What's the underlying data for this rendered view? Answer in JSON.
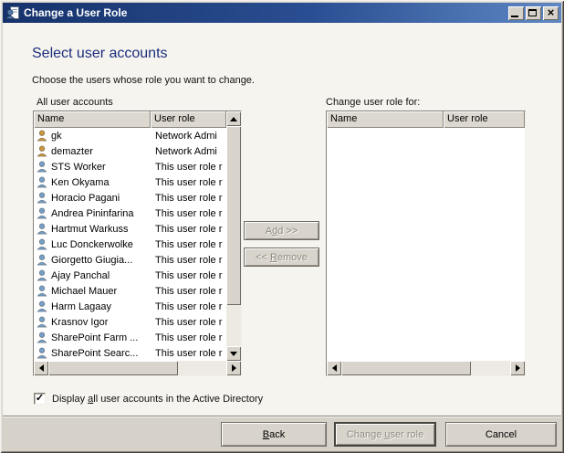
{
  "window": {
    "title": "Change a User Role",
    "close_glyph": "×"
  },
  "heading": "Select user accounts",
  "subheading": "Choose the users whose role you want to change.",
  "left_list": {
    "label": "All user accounts",
    "columns": [
      "Name",
      "User role"
    ],
    "users": [
      {
        "name": "gk",
        "role": "Network Admi",
        "type": "admin"
      },
      {
        "name": "demazter",
        "role": "Network Admi",
        "type": "admin"
      },
      {
        "name": "STS Worker",
        "role": "This user role r",
        "type": "user"
      },
      {
        "name": "Ken Okyama",
        "role": "This user role r",
        "type": "user"
      },
      {
        "name": "Horacio Pagani",
        "role": "This user role r",
        "type": "user"
      },
      {
        "name": "Andrea Pininfarina",
        "role": "This user role r",
        "type": "user"
      },
      {
        "name": "Hartmut Warkuss",
        "role": "This user role r",
        "type": "user"
      },
      {
        "name": "Luc Donckerwolke",
        "role": "This user role r",
        "type": "user"
      },
      {
        "name": "Giorgetto Giugia...",
        "role": "This user role r",
        "type": "user"
      },
      {
        "name": "Ajay Panchal",
        "role": "This user role r",
        "type": "user"
      },
      {
        "name": "Michael Mauer",
        "role": "This user role r",
        "type": "user"
      },
      {
        "name": "Harm Lagaay",
        "role": "This user role r",
        "type": "user"
      },
      {
        "name": "Krasnov Igor",
        "role": "This user role r",
        "type": "user"
      },
      {
        "name": "SharePoint Farm ...",
        "role": "This user role r",
        "type": "user"
      },
      {
        "name": "SharePoint Searc...",
        "role": "This user role r",
        "type": "user"
      }
    ]
  },
  "right_list": {
    "label": "Change user role for:",
    "columns": [
      "Name",
      "User role"
    ],
    "users": []
  },
  "transfer": {
    "add": {
      "pre": "A",
      "key": "d",
      "post": "d >>"
    },
    "remove": {
      "pre": "<< ",
      "key": "R",
      "post": "emove"
    }
  },
  "checkbox": {
    "checked": true,
    "check_glyph": "✓",
    "label": {
      "pre": "Display ",
      "key": "a",
      "post": "ll user accounts in the Active Directory"
    }
  },
  "footer": {
    "back": {
      "pre": "",
      "key": "B",
      "post": "ack"
    },
    "change": {
      "pre": "Change ",
      "key": "u",
      "post": "ser role"
    },
    "cancel": {
      "pre": "Cancel",
      "key": "",
      "post": ""
    }
  },
  "icons": {
    "titlebar": "user-document-icon",
    "list_user": "user-icon",
    "list_admin_user": "admin-user-icon",
    "window_buttons": [
      "minimize-icon",
      "maximize-icon",
      "close-icon"
    ],
    "scroll_arrows": [
      "arrow-up-icon",
      "arrow-down-icon",
      "arrow-left-icon",
      "arrow-right-icon"
    ]
  },
  "colors": {
    "titlebar_gradient_start": "#16326b",
    "titlebar_gradient_end": "#5e87c3",
    "content_background": "#f5f4ef",
    "chrome_background": "#d6d2c9",
    "heading_text": "#1d2d7c",
    "admin_icon": "#c9973d",
    "user_icon": "#76a0c8",
    "disabled_text": "#8f8b84"
  }
}
